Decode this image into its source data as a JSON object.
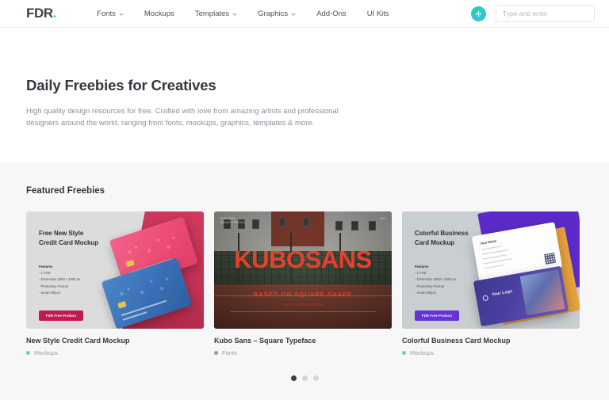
{
  "brand": {
    "name": "FDR",
    "dot": ".",
    "accent": "#2ec9c9"
  },
  "nav": {
    "items": [
      {
        "label": "Fonts",
        "has_dropdown": true
      },
      {
        "label": "Mockups",
        "has_dropdown": false
      },
      {
        "label": "Templates",
        "has_dropdown": true
      },
      {
        "label": "Graphics",
        "has_dropdown": true
      },
      {
        "label": "Add-Ons",
        "has_dropdown": false
      },
      {
        "label": "UI Kits",
        "has_dropdown": false
      }
    ]
  },
  "header": {
    "add_button_icon": "plus-icon",
    "search": {
      "placeholder": "Type and enter",
      "value": ""
    }
  },
  "hero": {
    "title": "Daily Freebies for Creatives",
    "subtitle": "High quality design resources for free. Crafted with love from amazing artists and professional designers around the world, ranging from fonts, mockups, graphics, templates & more."
  },
  "featured": {
    "heading": "Featured Freebies",
    "cards": [
      {
        "caption_title": "New Style Credit Card Mockup",
        "category": "Mockups",
        "category_color": "#7ec9a8",
        "art": {
          "headline_line1": "Free New Style",
          "headline_line2": "Credit Card Mockup",
          "features_heading": "Features",
          "features": [
            "- 1 PSD",
            "- Dimension 3000 x 2000 px",
            "- Photoshop Format",
            "- Smart Object"
          ],
          "button_label": "FDR Free Product",
          "button_color": "#c2194f"
        }
      },
      {
        "caption_title": "Kubo Sans – Square Typeface",
        "category": "Fonts",
        "category_color": "#9a93ad",
        "art": {
          "wordmark": "KUBOSANS",
          "tagline": "BASED ON SQUARE SHAPE",
          "tagline_small": "kubo sans typeface",
          "corner_left": "KUBO SANS\nSQUARE TYPEFACE",
          "corner_right": "2020",
          "accent_color": "#e8402e"
        }
      },
      {
        "caption_title": "Colorful Business Card Mockup",
        "category": "Mockups",
        "category_color": "#7ec9a8",
        "art": {
          "headline_line1": "Colorful Business",
          "headline_line2": "Card Mockup",
          "features_heading": "Features",
          "features": [
            "- 1 PSD",
            "- Dimension 3000 x 2000 px",
            "- Photoshop Format",
            "- Smart Object"
          ],
          "button_label": "FDR Free Product",
          "button_color": "#6432d6",
          "card_name": "Your Name",
          "card_logo": "Your Logo"
        }
      }
    ],
    "pagination": {
      "total": 3,
      "active_index": 0
    }
  }
}
